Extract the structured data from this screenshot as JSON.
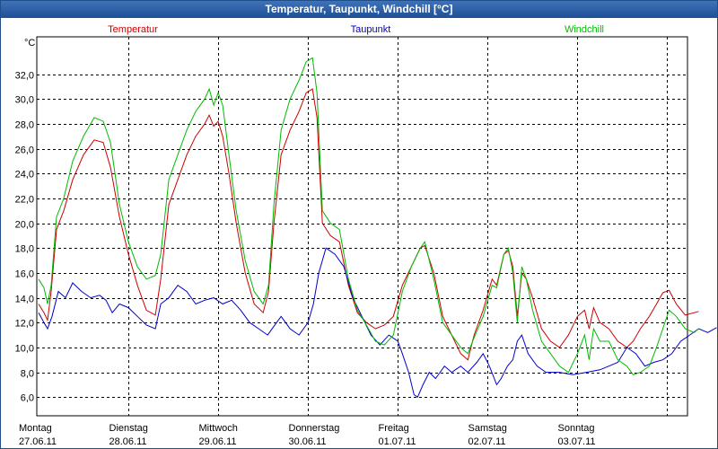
{
  "window": {
    "title": "Temperatur, Taupunkt, Windchill [°C]"
  },
  "chart_data": {
    "type": "line",
    "title": "Temperatur, Taupunkt, Windchill [°C]",
    "ylabel": "°C",
    "ylim": [
      4.5,
      35.0
    ],
    "y_ticks": [
      "6,0",
      "8,0",
      "10,0",
      "12,0",
      "14,0",
      "16,0",
      "18,0",
      "20,0",
      "22,0",
      "24,0",
      "26,0",
      "28,0",
      "30,0",
      "32,0"
    ],
    "y_tick_values": [
      6,
      8,
      10,
      12,
      14,
      16,
      18,
      20,
      22,
      24,
      26,
      28,
      30,
      32
    ],
    "x_range_days": [
      0,
      7
    ],
    "x_ticks": [
      {
        "day": "Montag",
        "date": "27.06.11"
      },
      {
        "day": "Dienstag",
        "date": "28.06.11"
      },
      {
        "day": "Mittwoch",
        "date": "29.06.11"
      },
      {
        "day": "Donnerstag",
        "date": "30.06.11"
      },
      {
        "day": "Freitag",
        "date": "01.07.11"
      },
      {
        "day": "Samstag",
        "date": "02.07.11"
      },
      {
        "day": "Sonntag",
        "date": "03.07.11"
      }
    ],
    "grid": true,
    "series": [
      {
        "name": "Temperatur",
        "color": "#cc0000",
        "points": [
          [
            0,
            13.5
          ],
          [
            0.06,
            12.8
          ],
          [
            0.1,
            12.2
          ],
          [
            0.14,
            14.5
          ],
          [
            0.2,
            19.5
          ],
          [
            0.28,
            21.0
          ],
          [
            0.38,
            23.5
          ],
          [
            0.5,
            25.5
          ],
          [
            0.62,
            26.7
          ],
          [
            0.72,
            26.5
          ],
          [
            0.8,
            24.5
          ],
          [
            0.9,
            20.5
          ],
          [
            1.0,
            17.5
          ],
          [
            1.1,
            15.0
          ],
          [
            1.2,
            13.0
          ],
          [
            1.3,
            12.6
          ],
          [
            1.36,
            15.5
          ],
          [
            1.45,
            21.5
          ],
          [
            1.55,
            23.5
          ],
          [
            1.65,
            25.5
          ],
          [
            1.75,
            27.0
          ],
          [
            1.85,
            28.0
          ],
          [
            1.9,
            28.7
          ],
          [
            1.95,
            27.8
          ],
          [
            2.0,
            28.2
          ],
          [
            2.05,
            27.0
          ],
          [
            2.12,
            24.0
          ],
          [
            2.2,
            20.0
          ],
          [
            2.3,
            16.0
          ],
          [
            2.4,
            13.5
          ],
          [
            2.5,
            12.8
          ],
          [
            2.56,
            14.5
          ],
          [
            2.62,
            20.0
          ],
          [
            2.7,
            25.5
          ],
          [
            2.8,
            27.5
          ],
          [
            2.9,
            29.0
          ],
          [
            2.98,
            30.5
          ],
          [
            3.05,
            30.8
          ],
          [
            3.1,
            28.5
          ],
          [
            3.16,
            20.0
          ],
          [
            3.25,
            19.0
          ],
          [
            3.35,
            18.5
          ],
          [
            3.45,
            15.0
          ],
          [
            3.55,
            12.8
          ],
          [
            3.65,
            12.0
          ],
          [
            3.75,
            11.5
          ],
          [
            3.85,
            11.8
          ],
          [
            3.95,
            12.5
          ],
          [
            4.05,
            15.0
          ],
          [
            4.15,
            16.5
          ],
          [
            4.25,
            18.0
          ],
          [
            4.3,
            18.2
          ],
          [
            4.4,
            16.0
          ],
          [
            4.5,
            12.5
          ],
          [
            4.6,
            11.0
          ],
          [
            4.7,
            9.5
          ],
          [
            4.78,
            9.0
          ],
          [
            4.85,
            11.0
          ],
          [
            4.95,
            13.0
          ],
          [
            5.05,
            15.5
          ],
          [
            5.1,
            15.0
          ],
          [
            5.18,
            17.5
          ],
          [
            5.23,
            17.8
          ],
          [
            5.28,
            16.5
          ],
          [
            5.33,
            12.5
          ],
          [
            5.38,
            16.0
          ],
          [
            5.43,
            15.5
          ],
          [
            5.5,
            14.0
          ],
          [
            5.6,
            11.5
          ],
          [
            5.7,
            10.5
          ],
          [
            5.8,
            10.0
          ],
          [
            5.9,
            11.0
          ],
          [
            6.0,
            12.5
          ],
          [
            6.08,
            13.0
          ],
          [
            6.13,
            11.5
          ],
          [
            6.18,
            13.2
          ],
          [
            6.25,
            12.0
          ],
          [
            6.35,
            11.5
          ],
          [
            6.45,
            10.5
          ],
          [
            6.55,
            10.0
          ],
          [
            6.62,
            10.5
          ],
          [
            6.7,
            11.5
          ],
          [
            6.8,
            12.5
          ],
          [
            6.88,
            13.5
          ],
          [
            6.95,
            14.4
          ],
          [
            7.02,
            14.6
          ],
          [
            7.1,
            13.5
          ],
          [
            7.2,
            12.6
          ],
          [
            7.3,
            12.8
          ],
          [
            7.35,
            12.9
          ]
        ]
      },
      {
        "name": "Taupunkt",
        "color": "#0000cc",
        "points": [
          [
            0,
            12.8
          ],
          [
            0.06,
            12.0
          ],
          [
            0.1,
            11.5
          ],
          [
            0.15,
            12.5
          ],
          [
            0.22,
            14.5
          ],
          [
            0.3,
            14.0
          ],
          [
            0.38,
            15.2
          ],
          [
            0.48,
            14.5
          ],
          [
            0.58,
            14.0
          ],
          [
            0.68,
            14.2
          ],
          [
            0.75,
            13.8
          ],
          [
            0.82,
            12.8
          ],
          [
            0.9,
            13.5
          ],
          [
            1.0,
            13.2
          ],
          [
            1.1,
            12.5
          ],
          [
            1.2,
            11.8
          ],
          [
            1.3,
            11.5
          ],
          [
            1.36,
            13.5
          ],
          [
            1.45,
            14.0
          ],
          [
            1.55,
            15.0
          ],
          [
            1.65,
            14.5
          ],
          [
            1.75,
            13.5
          ],
          [
            1.85,
            13.8
          ],
          [
            1.95,
            14.0
          ],
          [
            2.05,
            13.5
          ],
          [
            2.15,
            13.8
          ],
          [
            2.25,
            13.0
          ],
          [
            2.35,
            12.0
          ],
          [
            2.45,
            11.5
          ],
          [
            2.55,
            11.0
          ],
          [
            2.6,
            11.5
          ],
          [
            2.7,
            12.5
          ],
          [
            2.8,
            11.5
          ],
          [
            2.9,
            11.0
          ],
          [
            3.0,
            12.0
          ],
          [
            3.06,
            13.5
          ],
          [
            3.12,
            16.0
          ],
          [
            3.2,
            18.0
          ],
          [
            3.3,
            17.5
          ],
          [
            3.4,
            16.5
          ],
          [
            3.5,
            14.0
          ],
          [
            3.6,
            12.5
          ],
          [
            3.7,
            11.0
          ],
          [
            3.8,
            10.2
          ],
          [
            3.9,
            11.0
          ],
          [
            4.0,
            10.5
          ],
          [
            4.05,
            9.5
          ],
          [
            4.12,
            8.0
          ],
          [
            4.18,
            6.2
          ],
          [
            4.22,
            6.0
          ],
          [
            4.28,
            7.0
          ],
          [
            4.35,
            8.0
          ],
          [
            4.42,
            7.5
          ],
          [
            4.52,
            8.5
          ],
          [
            4.6,
            8.0
          ],
          [
            4.7,
            8.5
          ],
          [
            4.78,
            8.0
          ],
          [
            4.88,
            8.8
          ],
          [
            4.95,
            9.5
          ],
          [
            5.02,
            8.5
          ],
          [
            5.1,
            7.0
          ],
          [
            5.15,
            7.5
          ],
          [
            5.22,
            8.5
          ],
          [
            5.28,
            9.0
          ],
          [
            5.33,
            10.5
          ],
          [
            5.38,
            11.0
          ],
          [
            5.45,
            9.5
          ],
          [
            5.55,
            8.5
          ],
          [
            5.65,
            8.0
          ],
          [
            5.8,
            8.0
          ],
          [
            5.95,
            7.8
          ],
          [
            6.1,
            8.0
          ],
          [
            6.25,
            8.2
          ],
          [
            6.35,
            8.5
          ],
          [
            6.45,
            8.8
          ],
          [
            6.55,
            10.0
          ],
          [
            6.65,
            9.5
          ],
          [
            6.75,
            8.5
          ],
          [
            6.85,
            8.8
          ],
          [
            6.95,
            9.0
          ],
          [
            7.05,
            9.5
          ],
          [
            7.15,
            10.5
          ],
          [
            7.25,
            11.0
          ],
          [
            7.35,
            11.5
          ],
          [
            7.45,
            11.2
          ],
          [
            7.55,
            11.6
          ]
        ]
      },
      {
        "name": "Windchill",
        "color": "#00bb00",
        "points": [
          [
            0,
            15.5
          ],
          [
            0.06,
            14.8
          ],
          [
            0.1,
            13.5
          ],
          [
            0.14,
            15.0
          ],
          [
            0.2,
            20.5
          ],
          [
            0.28,
            22.0
          ],
          [
            0.38,
            25.0
          ],
          [
            0.5,
            27.0
          ],
          [
            0.62,
            28.5
          ],
          [
            0.72,
            28.2
          ],
          [
            0.8,
            26.5
          ],
          [
            0.9,
            21.5
          ],
          [
            1.0,
            18.5
          ],
          [
            1.1,
            16.5
          ],
          [
            1.2,
            15.5
          ],
          [
            1.3,
            15.8
          ],
          [
            1.36,
            17.5
          ],
          [
            1.45,
            23.5
          ],
          [
            1.55,
            25.5
          ],
          [
            1.65,
            27.5
          ],
          [
            1.75,
            29.0
          ],
          [
            1.85,
            30.0
          ],
          [
            1.9,
            30.8
          ],
          [
            1.95,
            29.5
          ],
          [
            2.0,
            30.5
          ],
          [
            2.05,
            29.5
          ],
          [
            2.12,
            25.5
          ],
          [
            2.2,
            21.0
          ],
          [
            2.3,
            17.0
          ],
          [
            2.4,
            14.5
          ],
          [
            2.5,
            13.5
          ],
          [
            2.56,
            15.0
          ],
          [
            2.62,
            21.5
          ],
          [
            2.7,
            27.5
          ],
          [
            2.8,
            30.0
          ],
          [
            2.9,
            31.5
          ],
          [
            2.98,
            33.0
          ],
          [
            3.05,
            33.3
          ],
          [
            3.1,
            30.5
          ],
          [
            3.16,
            21.0
          ],
          [
            3.25,
            20.0
          ],
          [
            3.35,
            19.5
          ],
          [
            3.45,
            15.5
          ],
          [
            3.55,
            13.0
          ],
          [
            3.65,
            11.8
          ],
          [
            3.75,
            10.5
          ],
          [
            3.85,
            10.2
          ],
          [
            3.95,
            11.0
          ],
          [
            4.05,
            14.5
          ],
          [
            4.15,
            16.5
          ],
          [
            4.25,
            18.0
          ],
          [
            4.3,
            18.5
          ],
          [
            4.4,
            15.5
          ],
          [
            4.5,
            12.0
          ],
          [
            4.6,
            11.0
          ],
          [
            4.7,
            10.0
          ],
          [
            4.78,
            9.5
          ],
          [
            4.85,
            10.8
          ],
          [
            4.95,
            12.5
          ],
          [
            5.05,
            15.0
          ],
          [
            5.1,
            14.8
          ],
          [
            5.18,
            17.5
          ],
          [
            5.23,
            18.0
          ],
          [
            5.28,
            16.0
          ],
          [
            5.33,
            12.0
          ],
          [
            5.38,
            16.5
          ],
          [
            5.43,
            15.5
          ],
          [
            5.5,
            13.0
          ],
          [
            5.6,
            10.5
          ],
          [
            5.7,
            9.5
          ],
          [
            5.8,
            8.5
          ],
          [
            5.9,
            8.0
          ],
          [
            6.0,
            9.5
          ],
          [
            6.08,
            11.0
          ],
          [
            6.13,
            9.0
          ],
          [
            6.18,
            11.5
          ],
          [
            6.25,
            10.5
          ],
          [
            6.35,
            10.5
          ],
          [
            6.45,
            9.0
          ],
          [
            6.55,
            8.5
          ],
          [
            6.62,
            7.8
          ],
          [
            6.7,
            8.0
          ],
          [
            6.8,
            8.5
          ],
          [
            6.88,
            10.0
          ],
          [
            6.95,
            11.5
          ],
          [
            7.02,
            13.0
          ],
          [
            7.1,
            12.5
          ],
          [
            7.2,
            11.5
          ],
          [
            7.3,
            11.2
          ],
          [
            7.35,
            11.5
          ]
        ]
      }
    ]
  }
}
